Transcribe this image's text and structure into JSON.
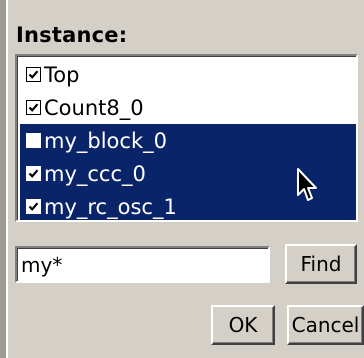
{
  "instance": {
    "label": "Instance:",
    "items": [
      {
        "label": "Top",
        "checked": true,
        "selected": false
      },
      {
        "label": "Count8_0",
        "checked": true,
        "selected": false
      },
      {
        "label": "my_block_0",
        "checked": false,
        "selected": true
      },
      {
        "label": "my_ccc_0",
        "checked": true,
        "selected": true
      },
      {
        "label": "my_rc_osc_1",
        "checked": true,
        "selected": true
      }
    ]
  },
  "search": {
    "value": "my*"
  },
  "buttons": {
    "find": "Find",
    "ok": "OK",
    "cancel": "Cancel"
  },
  "colors": {
    "selection": "#0a246a",
    "face": "#d4d0c8"
  }
}
